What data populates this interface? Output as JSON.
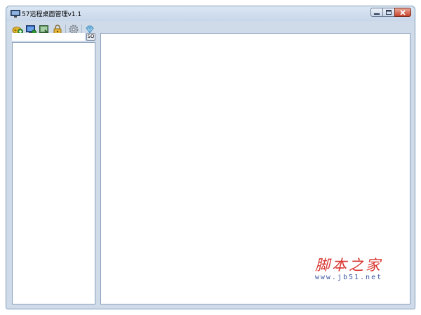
{
  "window": {
    "title": "57远程桌面管理v1.1",
    "controls": {
      "minimize": "minimize",
      "maximize": "maximize",
      "close": "close"
    }
  },
  "toolbar": {
    "buttons": [
      {
        "name": "add-host",
        "icon": "add-key-icon"
      },
      {
        "name": "connect",
        "icon": "monitor-icon"
      },
      {
        "name": "group",
        "icon": "group-icon"
      },
      {
        "name": "lock",
        "icon": "lock-icon"
      },
      {
        "name": "settings",
        "icon": "gear-icon"
      },
      {
        "name": "about",
        "icon": "gem-icon"
      }
    ]
  },
  "sidebar": {
    "search": {
      "value": "",
      "placeholder": ""
    },
    "go_label": "SO"
  },
  "watermark": {
    "title": "脚本之家",
    "url": "www.jb51.net"
  },
  "colors": {
    "window_bg": "#cfdbe9",
    "panel_border": "#8ba0bc",
    "watermark_red": "#d8352f",
    "watermark_blue": "#3a55a0"
  }
}
